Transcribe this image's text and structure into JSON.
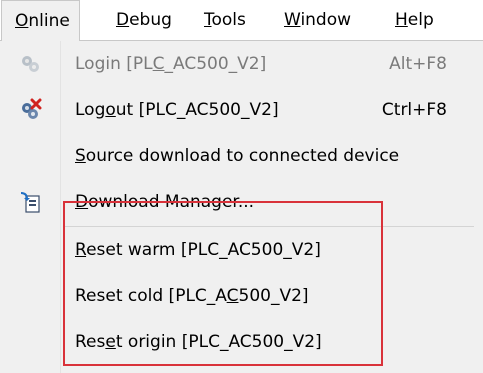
{
  "menubar": {
    "items": [
      {
        "pre": "",
        "u": "O",
        "post": "nline"
      },
      {
        "pre": "",
        "u": "D",
        "post": "ebug"
      },
      {
        "pre": "",
        "u": "T",
        "post": "ools"
      },
      {
        "pre": "",
        "u": "W",
        "post": "indow"
      },
      {
        "pre": "",
        "u": "H",
        "post": "elp"
      }
    ]
  },
  "menu": {
    "items": [
      {
        "pre": "Login [PL",
        "u": "C",
        "post": "_AC500_V2]",
        "shortcut": "Alt+F8",
        "icon": "login-icon",
        "enabled": false
      },
      {
        "pre": "Log",
        "u": "o",
        "post": "ut [PLC_AC500_V2]",
        "shortcut": "Ctrl+F8",
        "icon": "logout-icon",
        "enabled": true
      },
      {
        "pre": "",
        "u": "S",
        "post": "ource download to connected device",
        "shortcut": "",
        "icon": "",
        "enabled": true
      },
      {
        "pre": "",
        "u": "D",
        "post": "ownload Manager...",
        "shortcut": "",
        "icon": "download-manager-icon",
        "enabled": true
      },
      {
        "pre": "",
        "u": "R",
        "post": "eset warm [PLC_AC500_V2]",
        "shortcut": "",
        "icon": "",
        "enabled": true
      },
      {
        "pre": "Reset cold [PLC_A",
        "u": "C",
        "post": "500_V2]",
        "shortcut": "",
        "icon": "",
        "enabled": true
      },
      {
        "pre": "Res",
        "u": "e",
        "post": "t origin [PLC_AC500_V2]",
        "shortcut": "",
        "icon": "",
        "enabled": true
      }
    ]
  },
  "colors": {
    "highlight_border": "#d9323a",
    "disabled_text": "#7a7a7a"
  }
}
